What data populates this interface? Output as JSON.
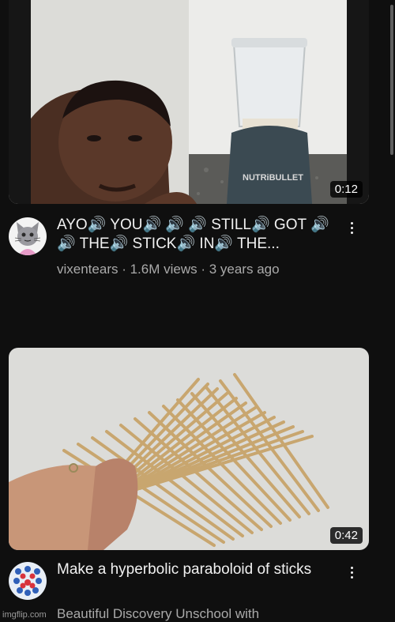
{
  "videos": [
    {
      "title": "AYO🔊 YOU🔊 🔊 🔊 STILL🔊 GOT 🔊 🔊 THE🔊 STICK🔊 IN🔊 THE...",
      "duration": "0:12",
      "channel_line": "vixentears · 1.6M views · 3 years ago",
      "thumbnail_text": "NUTRiBULLET",
      "thumbnail_icon": "nutribullet-blender-video-thumbnail",
      "avatar_icon": "cat-cartoon-avatar"
    },
    {
      "title": "Make a hyperbolic paraboloid of sticks",
      "duration": "0:42",
      "channel_line": "Beautiful Discovery Unschool with",
      "thumbnail_icon": "stick-grid-video-thumbnail",
      "avatar_icon": "blue-red-pattern-avatar"
    }
  ],
  "watermark": "imgflip.com",
  "colors": {
    "background": "#0f0f0f",
    "text_primary": "#f1f1f1",
    "text_secondary": "#aaaaaa"
  }
}
